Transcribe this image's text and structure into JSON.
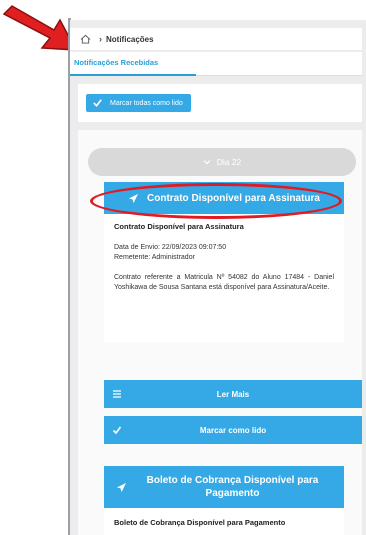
{
  "breadcrumb": {
    "page": "Notificações"
  },
  "tabs": {
    "received": "Notificações Recebidas"
  },
  "toolbar": {
    "mark_all_label": "Marcar todas como lido"
  },
  "day_group": {
    "label": "Dia 22"
  },
  "notifications": [
    {
      "title": "Contrato Disponível para Assinatura",
      "subtitle": "Contrato Disponível para Assinatura",
      "send_date": "Data de Envio: 22/09/2023 09:07:50",
      "sender": "Remetente: Administrador",
      "description": "Contrato referente a Matricula Nº 54082 do Aluno 17484 - Daniel Yoshikawa de Sousa Santana está disponível para Assinatura/Aceite.",
      "read_more_label": "Ler Mais",
      "mark_read_label": "Marcar como lido"
    },
    {
      "title": "Boleto de Cobrança Disponível para Pagamento",
      "subtitle": "Boleto de Cobrança Disponível para Pagamento"
    }
  ],
  "colors": {
    "accent": "#35a9e5",
    "tab": "#2a9fd6",
    "annotation": "#e01b24"
  },
  "icons": [
    "home-icon",
    "chevron-right-icon",
    "check-icon",
    "chevron-down-icon",
    "paper-plane-icon",
    "menu-icon"
  ]
}
